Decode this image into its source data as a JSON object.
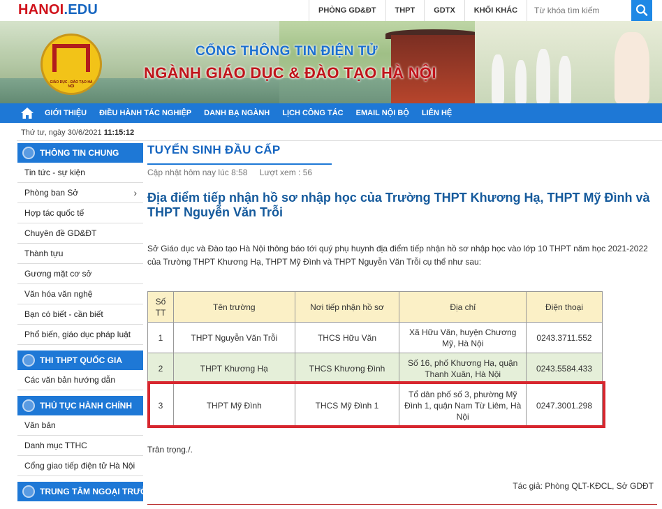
{
  "site": {
    "logo_part1": "HANOI",
    "logo_part2": ".EDU",
    "top_nav": [
      "PHÒNG GD&ĐT",
      "THPT",
      "GDTX",
      "KHỐI KHÁC"
    ],
    "search_placeholder": "Từ khóa tìm kiếm"
  },
  "banner": {
    "line1": "CỔNG THÔNG TIN ĐIỆN TỬ",
    "line2": "NGÀNH GIÁO DỤC & ĐÀO TẠO HÀ NỘI",
    "emblem_text": "GIÁO DỤC - ĐÀO TẠO HÀ NỘI"
  },
  "main_nav": [
    "GIỚI THIỆU",
    "ĐIỀU HÀNH TÁC NGHIỆP",
    "DANH BẠ NGÀNH",
    "LỊCH CÔNG TÁC",
    "EMAIL NỘI BỘ",
    "LIÊN HỆ"
  ],
  "datebar": {
    "date": "Thứ tư, ngày 30/6/2021",
    "time": "11:15:12"
  },
  "sidebar": {
    "sections": [
      {
        "title": "THÔNG TIN CHUNG",
        "items": [
          "Tin tức - sự kiện",
          "Phòng ban Sở",
          "Hợp tác quốc tế",
          "Chuyên đề GD&ĐT",
          "Thành tựu",
          "Gương mặt cơ sở",
          "Văn hóa văn nghệ",
          "Bạn có biết - cần biết",
          "Phổ biến, giáo dục pháp luật"
        ]
      },
      {
        "title": "THI THPT QUỐC GIA",
        "items": [
          "Các văn bản hướng dẫn"
        ]
      },
      {
        "title": "THỦ TỤC HÀNH CHÍNH",
        "items": [
          "Văn bản",
          "Danh mục TTHC",
          "Cổng giao tiếp điện tử Hà Nội"
        ]
      },
      {
        "title": "TRUNG TÂM NGOẠI TRƯỜNG",
        "items": []
      }
    ]
  },
  "article": {
    "category": "TUYỂN SINH ĐẦU CẤP",
    "updated": "Cập nhật hôm nay lúc 8:58",
    "views": "Lượt xem : 56",
    "title": "Địa điểm tiếp nhận hồ sơ nhập học của Trường THPT Khương Hạ, THPT Mỹ Đình và THPT Nguyễn Văn Trỗi",
    "intro": "Sở Giáo dục và Đào tạo Hà Nội thông báo tới quý phụ huynh địa điểm tiếp nhận hồ sơ nhập học vào lớp 10 THPT năm học 2021-2022 của Trường THPT Khương Hạ, THPT Mỹ Đình và THPT Nguyễn Văn Trỗi cụ thể như sau:",
    "table": {
      "headers": [
        "Số TT",
        "Tên trường",
        "Nơi tiếp nhận hồ sơ",
        "Địa chỉ",
        "Điện thoại"
      ],
      "rows": [
        [
          "1",
          "THPT Nguyễn Văn Trỗi",
          "THCS Hữu Văn",
          "Xã Hữu Văn, huyện Chương Mỹ, Hà Nội",
          "0243.3711.552"
        ],
        [
          "2",
          "THPT Khương Hạ",
          "THCS Khương Đình",
          "Số 16, phố Khương Hạ, quận Thanh Xuân, Hà Nội",
          "0243.5584.433"
        ],
        [
          "3",
          "THPT Mỹ Đình",
          "THCS Mỹ Đình 1",
          "Tổ dân phố số 3, phường Mỹ Đình 1, quận Nam Từ Liêm, Hà Nội",
          "0247.3001.298"
        ]
      ]
    },
    "closing": "Trân trọng./.",
    "author": "Tác giả: Phòng QLT-KĐCL, Sở GDĐT"
  },
  "colors": {
    "brand_red": "#d0121b",
    "brand_blue": "#1e78d6",
    "highlight": "#d7262e"
  }
}
